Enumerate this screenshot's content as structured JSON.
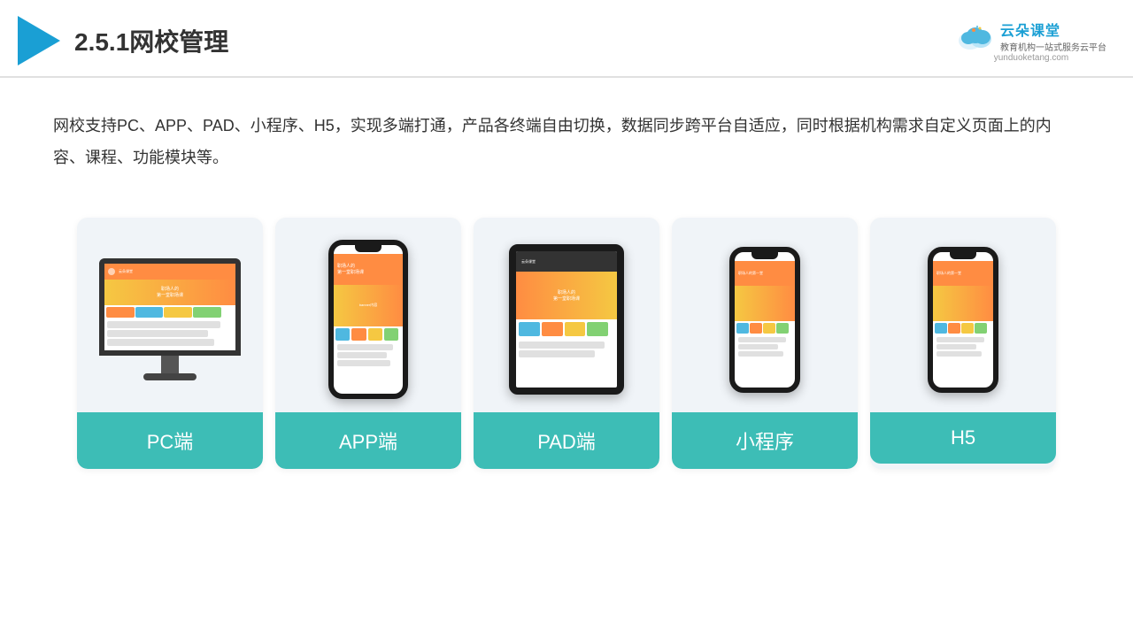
{
  "header": {
    "title": "2.5.1网校管理",
    "brand": {
      "name": "云朵课堂",
      "slogan": "教育机构一站式服务云平台",
      "url": "yunduoketang.com"
    }
  },
  "description": "网校支持PC、APP、PAD、小程序、H5，实现多端打通，产品各终端自由切换，数据同步跨平台自适应，同时根据机构需求自定义页面上的内容、课程、功能模块等。",
  "cards": [
    {
      "id": "pc",
      "label": "PC端",
      "type": "monitor"
    },
    {
      "id": "app",
      "label": "APP端",
      "type": "phone-tall"
    },
    {
      "id": "pad",
      "label": "PAD端",
      "type": "tablet"
    },
    {
      "id": "miniapp",
      "label": "小程序",
      "type": "phone"
    },
    {
      "id": "h5",
      "label": "H5",
      "type": "phone"
    }
  ]
}
